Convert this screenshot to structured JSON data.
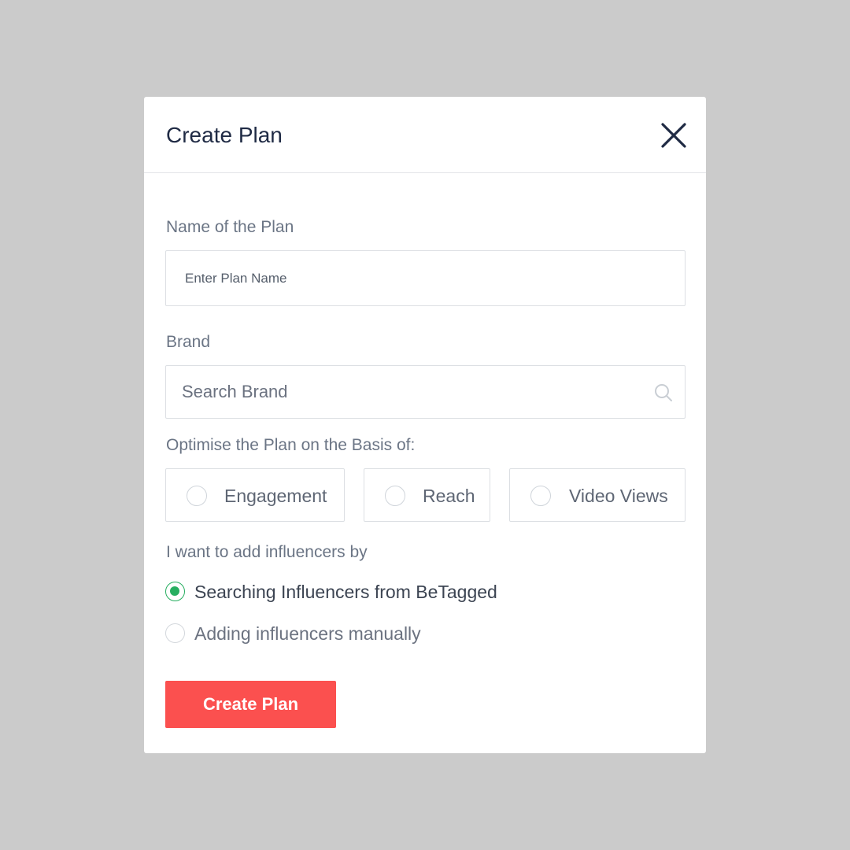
{
  "modal": {
    "title": "Create Plan",
    "close_icon": "close-icon"
  },
  "plan_name": {
    "label": "Name of the Plan",
    "placeholder": "Enter Plan Name",
    "value": ""
  },
  "brand": {
    "label": "Brand",
    "placeholder": "Search Brand",
    "value": "",
    "icon": "search-icon"
  },
  "optimise": {
    "label": "Optimise the Plan on the Basis of:",
    "options": [
      {
        "label": "Engagement",
        "selected": false
      },
      {
        "label": "Reach",
        "selected": false
      },
      {
        "label": "Video Views",
        "selected": false
      }
    ]
  },
  "add_method": {
    "label": "I want to add influencers by",
    "options": [
      {
        "label": "Searching Influencers from BeTagged",
        "selected": true
      },
      {
        "label": "Adding influencers manually",
        "selected": false
      }
    ]
  },
  "submit": {
    "label": "Create Plan"
  },
  "colors": {
    "background": "#cbcbcb",
    "accent": "#fb504f",
    "radio_checked": "#27ae60",
    "title": "#1f2a44"
  }
}
